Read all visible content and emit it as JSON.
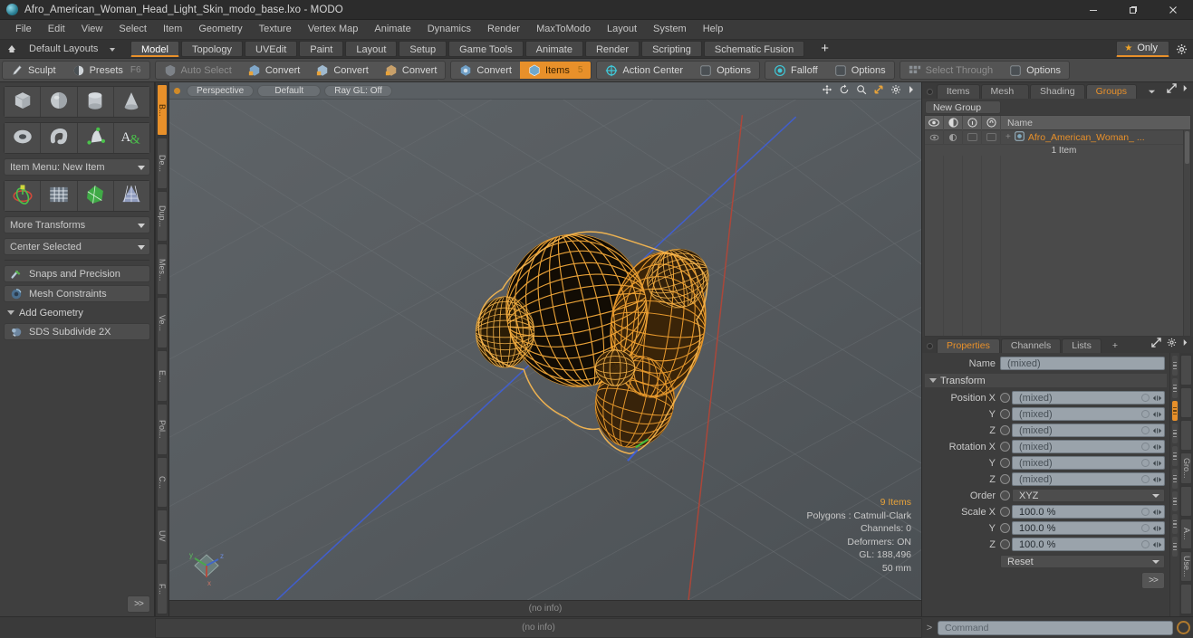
{
  "window": {
    "title": "Afro_American_Woman_Head_Light_Skin_modo_base.lxo - MODO",
    "minimize_label": "minimize-icon",
    "maximize_label": "restore-icon",
    "close_label": "close-icon"
  },
  "menubar": {
    "items": [
      "File",
      "Edit",
      "View",
      "Select",
      "Item",
      "Geometry",
      "Texture",
      "Vertex Map",
      "Animate",
      "Dynamics",
      "Render",
      "MaxToModo",
      "Layout",
      "System",
      "Help"
    ]
  },
  "layoutbar": {
    "home_icon": "home-icon",
    "layout_preset": "Default Layouts",
    "tabs": [
      "Model",
      "Topology",
      "UVEdit",
      "Paint",
      "Layout",
      "Setup",
      "Game Tools",
      "Animate",
      "Render",
      "Scripting",
      "Schematic Fusion"
    ],
    "active_tab": "Model",
    "add_tab_label": "+",
    "only_label": "Only",
    "gear_label": "settings-gear"
  },
  "modebar": {
    "groups": [
      {
        "buttons": [
          {
            "label": "Sculpt",
            "icon": "sculpt-brush-icon",
            "state": "normal"
          },
          {
            "label": "Presets",
            "icon": "presets-sphere-icon",
            "state": "normal",
            "shortcut": "F6"
          }
        ]
      },
      {
        "buttons": [
          {
            "label": "Auto Select",
            "icon": "auto-select-icon",
            "state": "disabled"
          },
          {
            "label": "Convert",
            "icon": "convert-vertex-icon",
            "state": "normal"
          },
          {
            "label": "Convert",
            "icon": "convert-edge-icon",
            "state": "normal"
          },
          {
            "label": "Convert",
            "icon": "convert-poly-icon",
            "state": "normal"
          }
        ]
      },
      {
        "buttons": [
          {
            "label": "Convert",
            "icon": "convert-item-icon",
            "state": "normal"
          },
          {
            "label": "Items",
            "icon": "items-icon",
            "state": "active",
            "badge": "5"
          }
        ]
      },
      {
        "buttons": [
          {
            "label": "Action Center",
            "icon": "action-center-icon",
            "state": "normal"
          },
          {
            "label": "Options",
            "icon": "options-square-icon",
            "state": "normal"
          }
        ]
      },
      {
        "buttons": [
          {
            "label": "Falloff",
            "icon": "falloff-icon",
            "state": "normal"
          },
          {
            "label": "Options",
            "icon": "options-square-icon",
            "state": "normal"
          }
        ]
      },
      {
        "buttons": [
          {
            "label": "Select Through",
            "icon": "select-through-icon",
            "state": "disabled"
          },
          {
            "label": "Options",
            "icon": "options-square-icon",
            "state": "normal"
          }
        ]
      }
    ]
  },
  "left_panel": {
    "primitives_row1": [
      "cube-primitive-icon",
      "sphere-primitive-icon",
      "cylinder-primitive-icon",
      "cone-primitive-icon"
    ],
    "primitives_row2": [
      "torus-primitive-icon",
      "capsule-primitive-icon",
      "bezier-shape-icon",
      "text-tool-icon"
    ],
    "item_menu": "Item Menu: New Item",
    "transform_row": [
      "transform-gizmo-icon",
      "grid-mesh-icon",
      "green-mesh-icon",
      "falloff-mesh-icon"
    ],
    "more_transforms": "More Transforms",
    "center_selected": "Center Selected",
    "snaps_precision": "Snaps and Precision",
    "mesh_constraints": "Mesh Constraints",
    "add_geometry": "Add Geometry",
    "sds_subdivide": "SDS Subdivide 2X",
    "forward_button": ">>",
    "vertical_tabs": [
      "B...",
      "De...",
      "Dup...",
      "Mes...",
      "Ve...",
      "E...",
      "Pol...",
      "C...",
      "UV",
      "F..."
    ],
    "active_vertical_tab": "B..."
  },
  "viewport": {
    "perspective": "Perspective",
    "shading": "Default",
    "raygl": "Ray GL: Off",
    "header_icons": [
      "move-view-icon",
      "rotate-view-icon",
      "zoom-view-icon",
      "fit-view-icon",
      "viewport-gear-icon",
      "viewport-more-icon"
    ],
    "axis_gizmo": "axis-gizmo-icon",
    "stats": {
      "items": "9 Items",
      "polygons": "Polygons : Catmull-Clark",
      "channels": "Channels: 0",
      "deformers": "Deformers: ON",
      "gl": "GL: 188,496",
      "scale": "50 mm"
    },
    "footer_info": "(no info)"
  },
  "right_panel": {
    "top_tabs": [
      "Items",
      "Mesh ...",
      "Shading",
      "Groups"
    ],
    "active_top_tab": "Groups",
    "top_tab_dropdown": "tab-overflow-icon",
    "expand_icon": "expand-panel-icon",
    "more_icon": "panel-more-icon",
    "new_group_button": "New Group",
    "tree": {
      "col_icons": [
        "eye-visibility-icon",
        "shadow-icon",
        "info-icon",
        "lock-icon"
      ],
      "name_header": "Name",
      "rows": [
        {
          "name": "Afro_American_Woman_ ...",
          "sub": "1 Item",
          "icon": "group-item-icon"
        }
      ]
    },
    "properties": {
      "tabs": [
        "Properties",
        "Channels",
        "Lists"
      ],
      "active_tab": "Properties",
      "add_tab": "+",
      "gear": "properties-gear-icon",
      "more": "properties-more-icon",
      "name_label": "Name",
      "name_value": "(mixed)",
      "transform_section": "Transform",
      "fields": [
        {
          "label": "Position X",
          "value": "(mixed)",
          "type": "numeric"
        },
        {
          "label": "Y",
          "value": "(mixed)",
          "type": "numeric"
        },
        {
          "label": "Z",
          "value": "(mixed)",
          "type": "numeric"
        },
        {
          "label": "Rotation X",
          "value": "(mixed)",
          "type": "numeric"
        },
        {
          "label": "Y",
          "value": "(mixed)",
          "type": "numeric"
        },
        {
          "label": "Z",
          "value": "(mixed)",
          "type": "numeric"
        },
        {
          "label": "Order",
          "value": "XYZ",
          "type": "dropdown"
        },
        {
          "label": "Scale X",
          "value": "100.0 %",
          "type": "numeric"
        },
        {
          "label": "Y",
          "value": "100.0 %",
          "type": "numeric"
        },
        {
          "label": "Z",
          "value": "100.0 %",
          "type": "numeric"
        }
      ],
      "reset_label": "Reset",
      "forward_button": ">>"
    },
    "vertical_tabs": [
      "Gro...",
      "A...",
      "Use..."
    ]
  },
  "statusbar": {
    "info": "(no info)",
    "prompt_arrow": ">",
    "command_placeholder": "Command",
    "record_icon": "record-ring-icon"
  },
  "colors": {
    "accent": "#e8902a",
    "wireframe": "#f0a030",
    "panel_bg": "#3d3d3d",
    "viewport_bg": "#555a5e",
    "field_bg": "#9aa3ab"
  }
}
